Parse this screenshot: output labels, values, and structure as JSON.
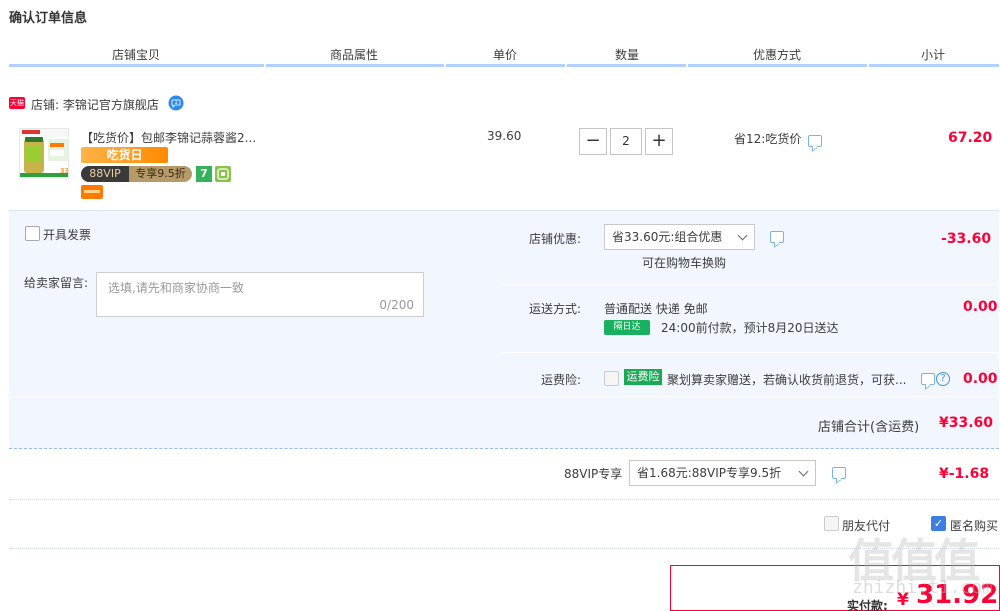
{
  "page_title": "确认订单信息",
  "columns": [
    "店铺宝贝",
    "商品属性",
    "单价",
    "数量",
    "优惠方式",
    "小计"
  ],
  "shop": {
    "badge": "天猫",
    "name": "店铺: 李锦记官方旗舰店",
    "wangwang_icon": "wangwang-chat-icon"
  },
  "product": {
    "title": "【吃货价】包邮李锦记蒜蓉酱2...",
    "tag_chihuo": "吃货日",
    "vip_left": "88VIP",
    "vip_right": "专享9.5折",
    "tag_seven": "7",
    "unit_price": "39.60",
    "quantity": "2",
    "qty_minus": "−",
    "qty_plus": "+",
    "promo": "省12:吃货价",
    "subtotal": "67.20"
  },
  "invoice": {
    "label": "开具发票"
  },
  "message": {
    "label": "给卖家留言:",
    "placeholder": "选填,请先和商家协商一致",
    "counter": "0/200"
  },
  "shop_discount": {
    "label": "店铺优惠:",
    "selected": "省33.60元:组合优惠",
    "hint": "可在购物车换购",
    "amount": "-33.60"
  },
  "shipping": {
    "label": "运送方式:",
    "method": "普通配送 快递 免邮",
    "badge": "隔日达",
    "eta": "24:00前付款，预计8月20日送达",
    "amount": "0.00"
  },
  "freight_insurance": {
    "label": "运费险:",
    "badge": "运费险",
    "text": "聚划算卖家赠送，若确认收货前退货，可获...",
    "help": "?",
    "amount": "0.00"
  },
  "shop_total": {
    "label": "店铺合计(含运费)",
    "amount": "¥33.60"
  },
  "vip_discount": {
    "label": "88VIP专享",
    "selected": "省1.68元:88VIP专享9.5折",
    "amount": "¥-1.68"
  },
  "options": {
    "friend_pay": "朋友代付",
    "anonymous": "匿名购买"
  },
  "payment": {
    "label": "实付款:",
    "currency": "¥",
    "amount": "31.92"
  },
  "watermark": {
    "text": "值值值",
    "url": "zhizhi.t1.com"
  },
  "colors": {
    "accent_red": "#ff0036",
    "panel_bg": "#f2f7ff",
    "header_line": "#b2d1ff",
    "checkbox_blue": "#3d7fe0",
    "green_badge": "#1aaa55"
  }
}
